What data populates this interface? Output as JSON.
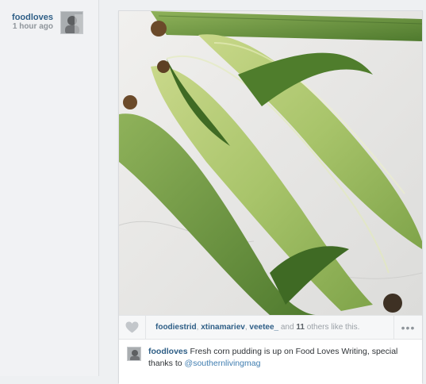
{
  "post": {
    "username": "foodloves",
    "time_ago": "1 hour ago",
    "photo_subject": "ears of corn in husks on marble",
    "likes": {
      "users": [
        "foodiestrid",
        "xtinamariev",
        "veetee_"
      ],
      "sep_1": ", ",
      "sep_2": ", ",
      "and_text": " and ",
      "others_count": "11",
      "others_suffix": " others like this."
    },
    "more_label": "•••",
    "caption": {
      "username": "foodloves",
      "text": " Fresh corn pudding is up on Food Loves Writing, special thanks to ",
      "mention": "@southernlivingmag"
    }
  },
  "icons": {
    "like": "heart-icon",
    "more": "ellipsis-icon"
  },
  "colors": {
    "link_blue": "#2e5e86",
    "mention_blue": "#3f7db0",
    "muted_gray": "#9aa0a6",
    "background": "#eef0f2"
  }
}
